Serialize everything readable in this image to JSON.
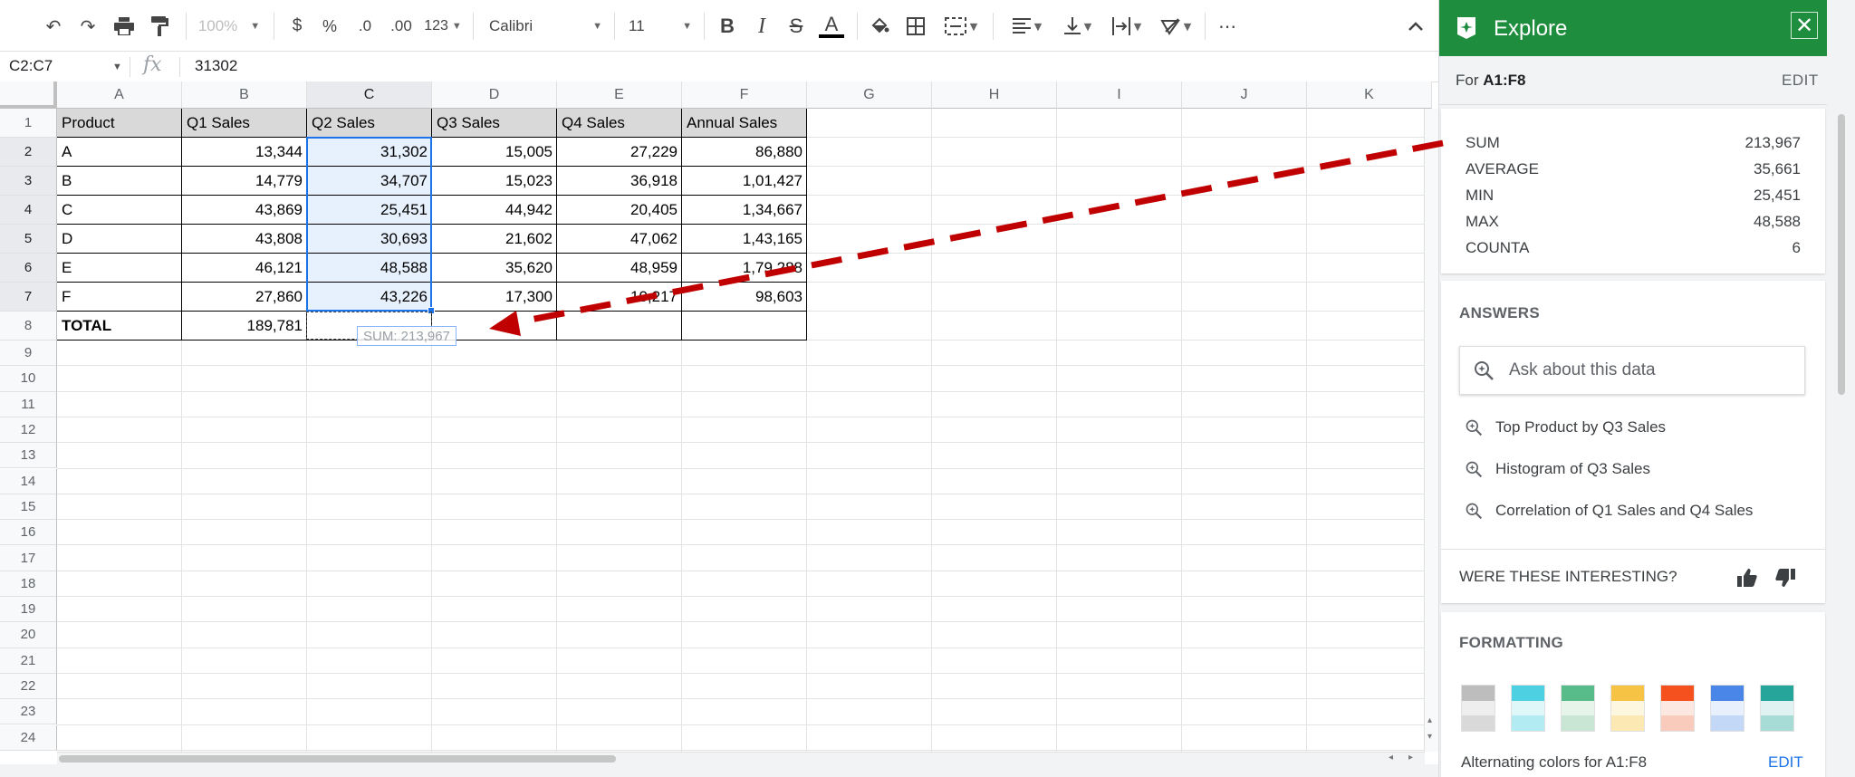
{
  "toolbar": {
    "zoom": "100%",
    "currency": "$",
    "percent": "%",
    "decrease_decimal": ".0",
    "increase_decimal": ".00",
    "more_formats": "123",
    "font": "Calibri",
    "font_size": "11",
    "more": "⋯"
  },
  "formula_bar": {
    "name_box": "C2:C7",
    "fx": "fx",
    "value": "31302"
  },
  "sheet": {
    "columns": [
      "A",
      "B",
      "C",
      "D",
      "E",
      "F",
      "G",
      "H",
      "I",
      "J",
      "K"
    ],
    "rows": [
      "1",
      "2",
      "3",
      "4",
      "5",
      "6",
      "7",
      "8",
      "9",
      "10",
      "11",
      "12",
      "13",
      "14",
      "15",
      "16",
      "17",
      "18",
      "19",
      "20",
      "21",
      "22",
      "23",
      "24"
    ],
    "headers": [
      "Product",
      "Q1 Sales",
      "Q2 Sales",
      "Q3 Sales",
      "Q4 Sales",
      "Annual Sales"
    ],
    "data": [
      [
        "A",
        "13,344",
        "31,302",
        "15,005",
        "27,229",
        "86,880"
      ],
      [
        "B",
        "14,779",
        "34,707",
        "15,023",
        "36,918",
        "1,01,427"
      ],
      [
        "C",
        "43,869",
        "25,451",
        "44,942",
        "20,405",
        "1,34,667"
      ],
      [
        "D",
        "43,808",
        "30,693",
        "21,602",
        "47,062",
        "1,43,165"
      ],
      [
        "E",
        "46,121",
        "48,588",
        "35,620",
        "48,959",
        "1,79,288"
      ],
      [
        "F",
        "27,860",
        "43,226",
        "17,300",
        "10,217",
        "98,603"
      ]
    ],
    "total_row": [
      "TOTAL",
      "189,781",
      "",
      "",
      "",
      ""
    ],
    "sum_tooltip": "SUM: 213,967"
  },
  "explore": {
    "title": "Explore",
    "close": "✕",
    "range_prefix": "For",
    "range": "A1:F8",
    "range_edit": "EDIT",
    "stats": [
      {
        "label": "SUM",
        "value": "213,967"
      },
      {
        "label": "AVERAGE",
        "value": "35,661"
      },
      {
        "label": "MIN",
        "value": "25,451"
      },
      {
        "label": "MAX",
        "value": "48,588"
      },
      {
        "label": "COUNTA",
        "value": "6"
      }
    ],
    "answers_title": "ANSWERS",
    "ask_placeholder": "Ask about this data",
    "answers": [
      "Top Product by Q3 Sales",
      "Histogram of Q3 Sales",
      "Correlation of Q1 Sales and Q4 Sales"
    ],
    "interesting_question": "WERE THESE INTERESTING?",
    "formatting_title": "FORMATTING",
    "swatch_colors": [
      [
        "#bdbdbd",
        "#eeeeee",
        "#d9d9d9"
      ],
      [
        "#4dd0e1",
        "#e0f7fa",
        "#b2ebf2"
      ],
      [
        "#57bb8a",
        "#e6f4ea",
        "#c8e6d3"
      ],
      [
        "#f6c344",
        "#fef7e0",
        "#fce8b2"
      ],
      [
        "#f4511e",
        "#fde7e1",
        "#f9cbbd"
      ],
      [
        "#4a86e8",
        "#e8f0fe",
        "#c3d7f7"
      ],
      [
        "#26a69a",
        "#e0f2f1",
        "#a7dbd5"
      ]
    ],
    "alt_colors_prefix": "Alternating colors for",
    "alt_colors_range": "A1:F8",
    "format_edit": "EDIT"
  },
  "colors": {
    "explore_green": "#1e8e3e",
    "selection_blue": "#1a73e8",
    "arrow_red": "#c00000"
  }
}
